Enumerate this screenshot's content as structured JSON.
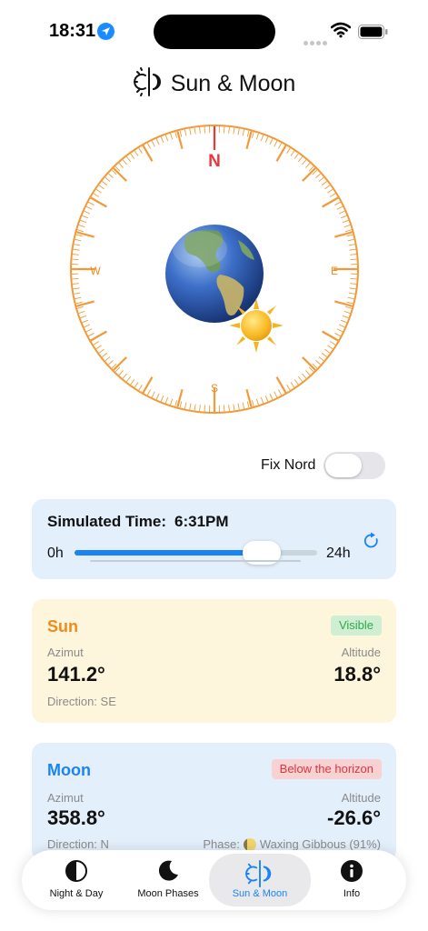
{
  "status_bar": {
    "time": "18:31"
  },
  "header": {
    "title": "Sun & Moon"
  },
  "compass": {
    "north": "N",
    "south": "S",
    "east": "E",
    "west": "W",
    "ring_color": "#f29a3a",
    "north_color": "#e8383d"
  },
  "fix_nord": {
    "label": "Fix Nord",
    "enabled": false
  },
  "simulated_time": {
    "label": "Simulated Time:",
    "value": "6:31PM",
    "min_label": "0h",
    "max_label": "24h",
    "progress": 0.7715
  },
  "sun": {
    "title": "Sun",
    "status": "Visible",
    "azimuth_label": "Azimut",
    "azimuth": "141.2°",
    "altitude_label": "Altitude",
    "altitude": "18.8°",
    "direction": "Direction: SE"
  },
  "moon": {
    "title": "Moon",
    "status": "Below the horizon",
    "azimuth_label": "Azimut",
    "azimuth": "358.8°",
    "altitude_label": "Altitude",
    "altitude": "-26.6°",
    "direction": "Direction: N",
    "phase_label": "Phase:",
    "phase": "Waxing Gibbous (91%)"
  },
  "tabs": [
    {
      "label": "Night & Day",
      "icon": "half-circle-icon",
      "active": false
    },
    {
      "label": "Moon Phases",
      "icon": "crescent-moon-icon",
      "active": false
    },
    {
      "label": "Sun & Moon",
      "icon": "sun-moon-icon",
      "active": true
    },
    {
      "label": "Info",
      "icon": "info-icon",
      "active": false
    }
  ],
  "colors": {
    "accent": "#1a84f5",
    "sun_orange": "#f28a1b",
    "visible_green": "#2fa84a",
    "below_red": "#e0353f"
  }
}
